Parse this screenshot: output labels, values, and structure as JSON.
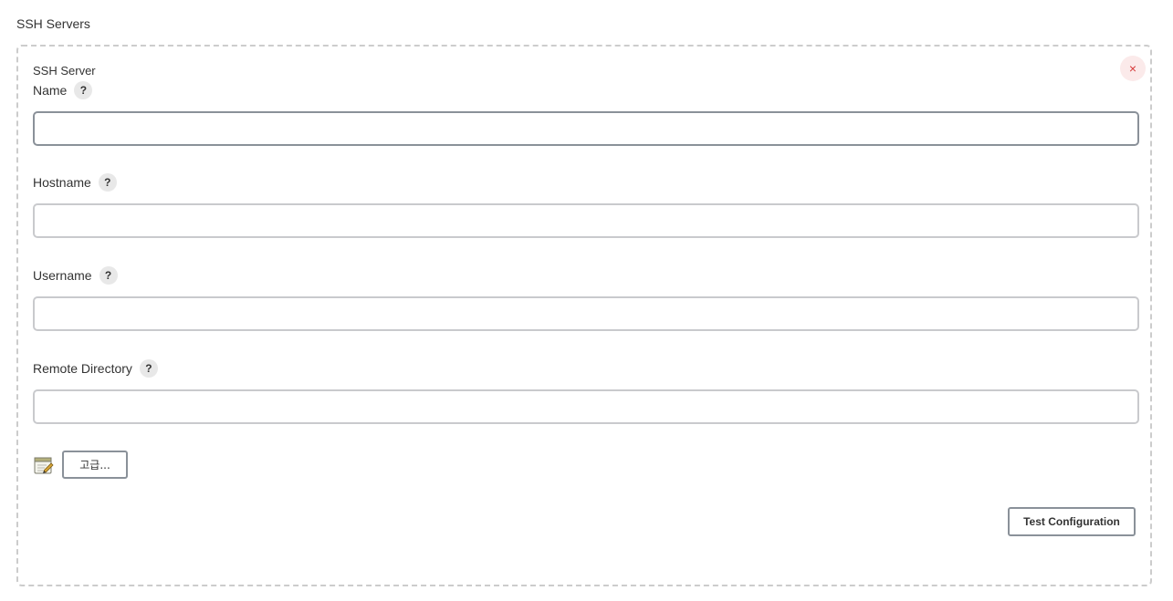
{
  "section": {
    "title": "SSH Servers"
  },
  "server": {
    "header": "SSH Server",
    "delete_symbol": "×",
    "help_symbol": "?",
    "fields": {
      "name": {
        "label": "Name",
        "value": ""
      },
      "hostname": {
        "label": "Hostname",
        "value": ""
      },
      "username": {
        "label": "Username",
        "value": ""
      },
      "remote_directory": {
        "label": "Remote Directory",
        "value": ""
      }
    },
    "advanced_label": "고급...",
    "test_label": "Test Configuration"
  },
  "colors": {
    "delete_accent": "#d63a3a",
    "input_border": "#c9cacd",
    "button_border": "#8a9199"
  },
  "icons": {
    "delete": "close-icon",
    "help": "help-icon",
    "notes": "notepad-icon"
  }
}
